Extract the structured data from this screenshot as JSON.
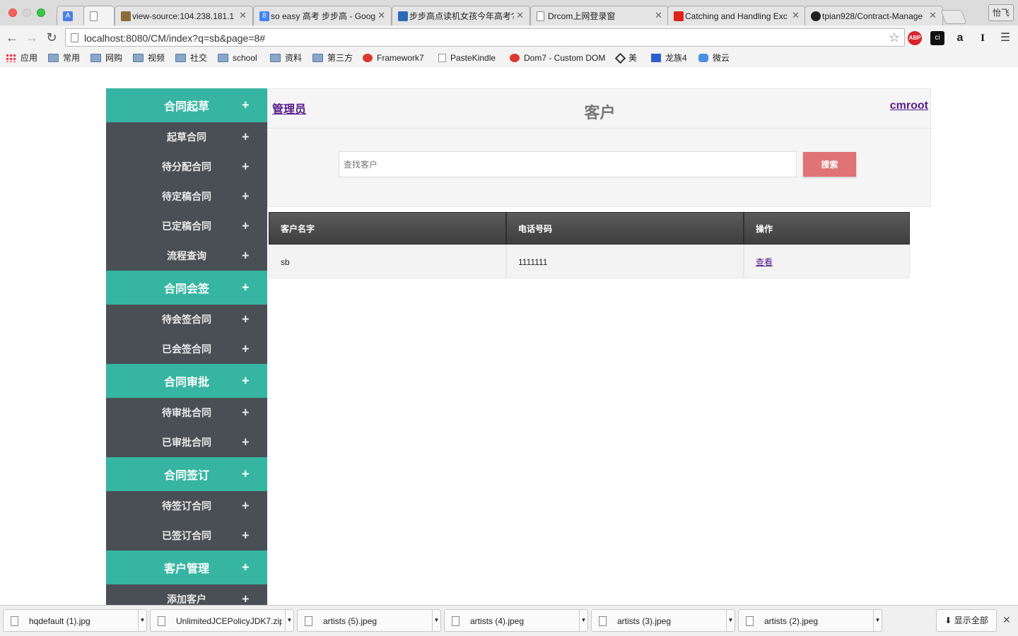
{
  "browser": {
    "tabs": [
      {
        "label": "",
        "icon": "translate-icon",
        "color": "#4a7fe0"
      },
      {
        "label": "",
        "icon": "page-icon",
        "color": "#ffffff"
      },
      {
        "label": "view-source:104.238.181.1",
        "icon": "image-icon",
        "color": "#8a6d3b"
      },
      {
        "label": "so easy 高考 步步高 - Goog",
        "icon": "google-icon",
        "color": "#4285f4"
      },
      {
        "label": "步步高点读机女孩今年高考?",
        "icon": "bbg-icon",
        "color": "#2b6ab7"
      },
      {
        "label": "Drcom上网登录窗",
        "icon": "page-icon",
        "color": "#ffffff"
      },
      {
        "label": "Catching and Handling Exc",
        "icon": "oracle-icon",
        "color": "#e2231a"
      },
      {
        "label": "tpian928/Contract-Manage",
        "icon": "github-icon",
        "color": "#222222"
      }
    ],
    "profile_name": "怡飞",
    "url": "localhost:8080/CM/index?q=sb&page=8#",
    "bookmarks": [
      "应用",
      "常用",
      "网购",
      "视频",
      "社交",
      "school",
      "资料",
      "第三方",
      "Framework7",
      "PasteKindle",
      "Dom7 - Custom DOM",
      "美",
      "龙族4",
      "微云"
    ]
  },
  "sidebar": {
    "groups": [
      {
        "title": "合同起草",
        "items": [
          "起草合同",
          "待分配合同",
          "待定稿合同",
          "已定稿合同",
          "流程查询"
        ]
      },
      {
        "title": "合同会签",
        "items": [
          "待会签合同",
          "已会签合同"
        ]
      },
      {
        "title": "合同审批",
        "items": [
          "待审批合同",
          "已审批合同"
        ]
      },
      {
        "title": "合同签订",
        "items": [
          "待签订合同",
          "已签订合同"
        ]
      },
      {
        "title": "客户管理",
        "items": [
          "添加客户"
        ]
      }
    ],
    "plus": "+",
    "accent": "#36b5a2",
    "dark": "#4a4f56"
  },
  "header": {
    "role_link": "管理员",
    "title": "客户",
    "user_link": "cmroot"
  },
  "search": {
    "placeholder": "查找客户",
    "button": "搜索",
    "button_color": "#e07375"
  },
  "table": {
    "columns": [
      "客户名字",
      "电话号码",
      "操作"
    ],
    "rows": [
      {
        "name": "sb",
        "phone": "1111111",
        "action": "查看"
      }
    ]
  },
  "downloads": {
    "files": [
      "hqdefault (1).jpg",
      "UnlimitedJCEPolicyJDK7.zip",
      "artists (5).jpeg",
      "artists (4).jpeg",
      "artists (3).jpeg",
      "artists (2).jpeg"
    ],
    "show_all": "显示全部"
  }
}
